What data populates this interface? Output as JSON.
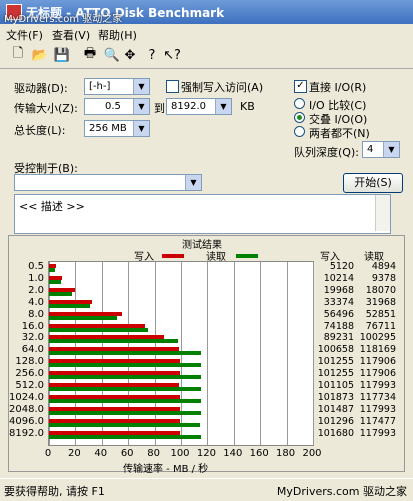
{
  "title": "无标题 - ATTO Disk Benchmark",
  "watermark_top": "MyDrivers.com 驱动之家",
  "watermark_bottom": "MyDrivers.com 驱动之家",
  "menu": [
    "文件(F)",
    "查看(V)",
    "帮助(H)"
  ],
  "form": {
    "drive_label": "驱动器(D):",
    "drive_value": "[-h-]",
    "force_write_label": "强制写入访问(A)",
    "direct_io_label": "直接 I/O(R)",
    "transfer_label": "传输大小(Z):",
    "transfer_from": "0.5",
    "to_label": "到",
    "transfer_to": "8192.0",
    "kb_label": "KB",
    "total_length_label": "总长度(L):",
    "total_length_value": "256 MB",
    "io_compare_label": "I/O 比较(C)",
    "overlapped_io_label": "交叠 I/O(O)",
    "neither_label": "两者都不(N)",
    "queue_depth_label": "队列深度(Q):",
    "queue_depth_value": "4",
    "controlled_by_label": "受控制于(B):",
    "controlled_by_value": "",
    "start_button": "开始(S)",
    "description": "<< 描述 >>"
  },
  "chart_data": {
    "type": "bar",
    "title": "测试结果",
    "legend": {
      "write": "写入",
      "read": "读取"
    },
    "columns": {
      "write": "写入",
      "read": "读取"
    },
    "categories": [
      "0.5",
      "1.0",
      "2.0",
      "4.0",
      "8.0",
      "16.0",
      "32.0",
      "64.0",
      "128.0",
      "256.0",
      "512.0",
      "1024.0",
      "2048.0",
      "4096.0",
      "8192.0"
    ],
    "series": [
      {
        "name": "写入",
        "color": "#cc0000",
        "values": [
          5120,
          10214,
          19968,
          33374,
          56496,
          74188,
          89231,
          100658,
          101255,
          101255,
          101105,
          101873,
          101487,
          101296,
          101680
        ]
      },
      {
        "name": "读取",
        "color": "#008000",
        "values": [
          4894,
          9378,
          18070,
          31968,
          52851,
          76711,
          100295,
          118169,
          117906,
          117906,
          117993,
          117734,
          117993,
          117477,
          117993
        ]
      }
    ],
    "xlabel": "传输速率 - MB / 秒",
    "xticks": [
      "0",
      "20",
      "40",
      "60",
      "80",
      "100",
      "120",
      "140",
      "160",
      "180",
      "200"
    ],
    "xlim": [
      0,
      200
    ]
  },
  "status": "要获得帮助, 请按 F1"
}
